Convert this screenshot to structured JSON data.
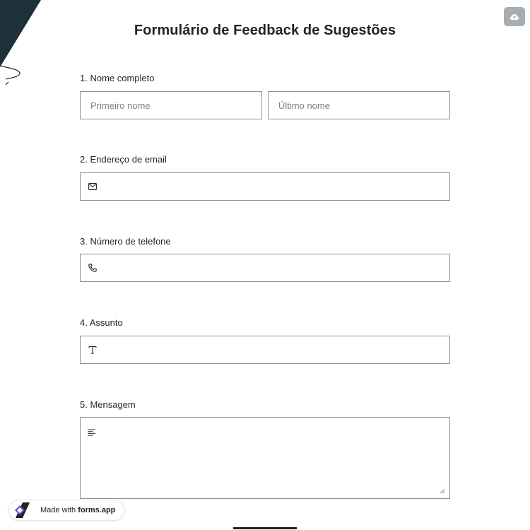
{
  "form": {
    "title": "Formulário de Feedback de Sugestões"
  },
  "questions": [
    {
      "label": "1.  Nome completo",
      "first_placeholder": "Primeiro nome",
      "last_placeholder": "Último nome",
      "icon": "none"
    },
    {
      "label": "2. Endereço de email",
      "icon": "envelope-icon"
    },
    {
      "label": "3. Número de telefone",
      "icon": "phone-icon"
    },
    {
      "label": "4. Assunto",
      "icon": "text-t-icon"
    },
    {
      "label": "5. Mensagem",
      "icon": "align-left-icon"
    }
  ],
  "badge": {
    "prefix": "Made with ",
    "brand": "forms.app",
    "icon": "forms-app-logo-icon"
  },
  "toolbar": {
    "cloud_icon": "cloud-upload-icon"
  },
  "colors": {
    "text": "#1f2328",
    "border": "#8c9196",
    "cloud_button": "#a7adb3",
    "logo_purple": "#6c4bd6"
  }
}
